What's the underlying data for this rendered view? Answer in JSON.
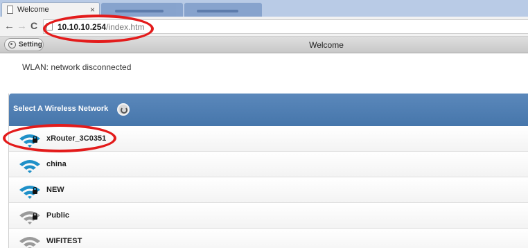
{
  "browser": {
    "tab_title": "Welcome",
    "tab_close": "×",
    "url_host": "10.10.10.254",
    "url_path": "/index.htm"
  },
  "app": {
    "setting_label": "Setting",
    "title": "Welcome",
    "wlan_status": "WLAN: network disconnected"
  },
  "network_list": {
    "header": "Select A Wireless Network",
    "networks": [
      {
        "ssid": "xRouter_3C0351",
        "secured": true,
        "signal_color": "#1e90c8"
      },
      {
        "ssid": "china",
        "secured": false,
        "signal_color": "#1e90c8"
      },
      {
        "ssid": "NEW",
        "secured": true,
        "signal_color": "#1e90c8"
      },
      {
        "ssid": "Public",
        "secured": true,
        "signal_color": "#8a8a8a"
      },
      {
        "ssid": "WIFITEST",
        "secured": false,
        "signal_color": "#8a8a8a"
      }
    ]
  },
  "colors": {
    "header_blue": "#4676ab",
    "annotation_red": "#e31b1b",
    "wifi_blue": "#1e90c8",
    "wifi_gray": "#8a8a8a"
  }
}
